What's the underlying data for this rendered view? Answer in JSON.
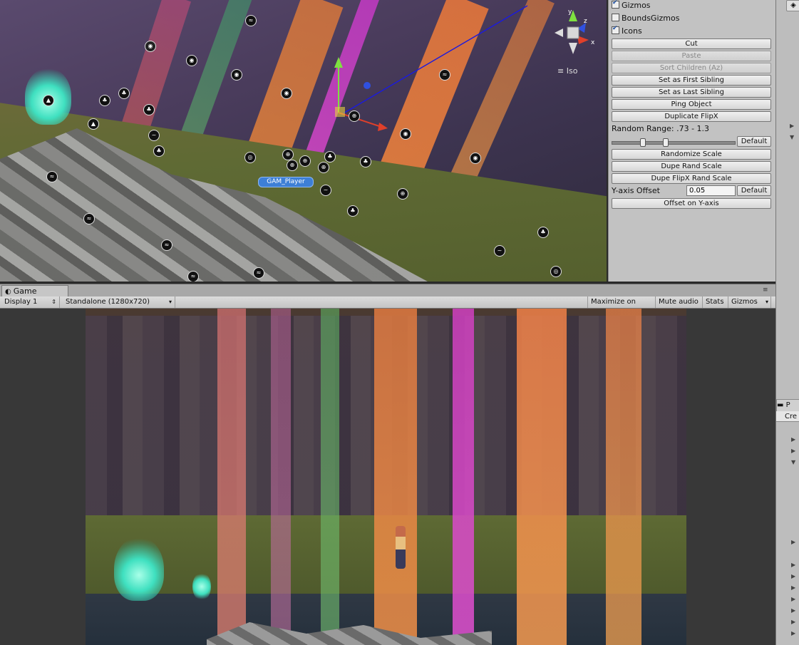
{
  "scene": {
    "player_label": "GAM_Player",
    "projection_label": "Iso",
    "gizmo_axes": {
      "y": "y",
      "z": "z",
      "x": "x"
    }
  },
  "inspector": {
    "toggles": [
      {
        "label": "Gizmos",
        "checked": true
      },
      {
        "label": "BoundsGizmos",
        "checked": false
      },
      {
        "label": "Icons",
        "checked": true
      }
    ],
    "buttons_top": [
      {
        "label": "Cut",
        "enabled": true
      },
      {
        "label": "Paste",
        "enabled": false
      },
      {
        "label": "Sort Children (Az)",
        "enabled": false
      },
      {
        "label": "Set as First Sibling",
        "enabled": true
      },
      {
        "label": "Set as Last Sibling",
        "enabled": true
      },
      {
        "label": "Ping Object",
        "enabled": true
      },
      {
        "label": "Duplicate FlipX",
        "enabled": true
      }
    ],
    "random_range_label": "Random Range: .73 - 1.3",
    "random_range": {
      "min": 0.73,
      "max": 1.3
    },
    "default_label": "Default",
    "buttons_mid": [
      {
        "label": "Randomize Scale"
      },
      {
        "label": "Dupe Rand Scale"
      },
      {
        "label": "Dupe FlipX Rand Scale"
      }
    ],
    "y_offset_label": "Y-axis Offset",
    "y_offset_value": "0.05",
    "offset_button": "Offset on Y-axis"
  },
  "game": {
    "tab_label": "Game",
    "display": "Display 1",
    "resolution": "Standalone (1280x720)",
    "toolbar": [
      "Maximize on Play",
      "Mute audio",
      "Stats",
      "Gizmos"
    ]
  },
  "right_panel": {
    "tab_label": "P",
    "create_label": "Cre"
  }
}
